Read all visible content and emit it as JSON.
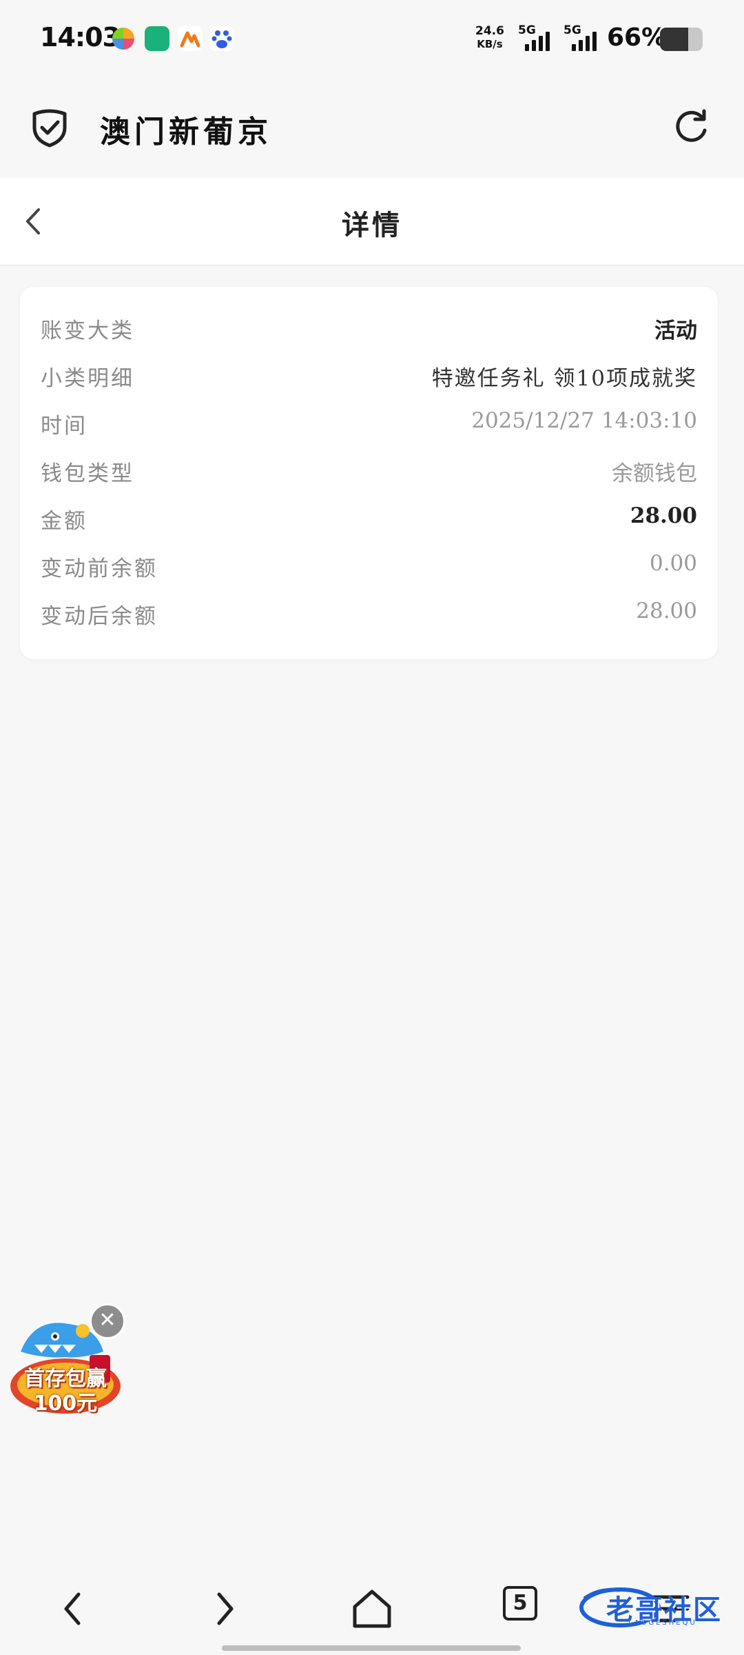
{
  "status_bar": {
    "time": "14:03",
    "net_speed_value": "24.6",
    "net_speed_unit": "KB/s",
    "sim1_label": "5G",
    "sim2_label": "5G",
    "battery_pct": "66%",
    "battery_level": 0.66,
    "app_icons": [
      "colorful-app-icon",
      "wifi-app-icon",
      "orange-app-icon",
      "baidu-paw-icon"
    ]
  },
  "app_header": {
    "title": "澳门新葡京"
  },
  "detail_header": {
    "title": "详情"
  },
  "details": [
    {
      "label": "账变大类",
      "value": "活动",
      "style": "bold"
    },
    {
      "label": "小类明细",
      "value": "特邀任务礼 领10项成就奖",
      "style": "dark"
    },
    {
      "label": "时间",
      "value": "2025/12/27 14:03:10",
      "style": "muted"
    },
    {
      "label": "钱包类型",
      "value": "余额钱包",
      "style": "muted"
    },
    {
      "label": "金额",
      "value": "28.00",
      "style": "bold"
    },
    {
      "label": "变动前余额",
      "value": "0.00",
      "style": "muted"
    },
    {
      "label": "变动后余额",
      "value": "28.00",
      "style": "muted"
    }
  ],
  "promo": {
    "line1": "首存包赢",
    "line2": "100元",
    "close_symbol": "✕"
  },
  "bottom_nav": {
    "tab_count": "5"
  },
  "watermark": {
    "text": "老哥社区",
    "sub": "LAOGESHEQU"
  }
}
